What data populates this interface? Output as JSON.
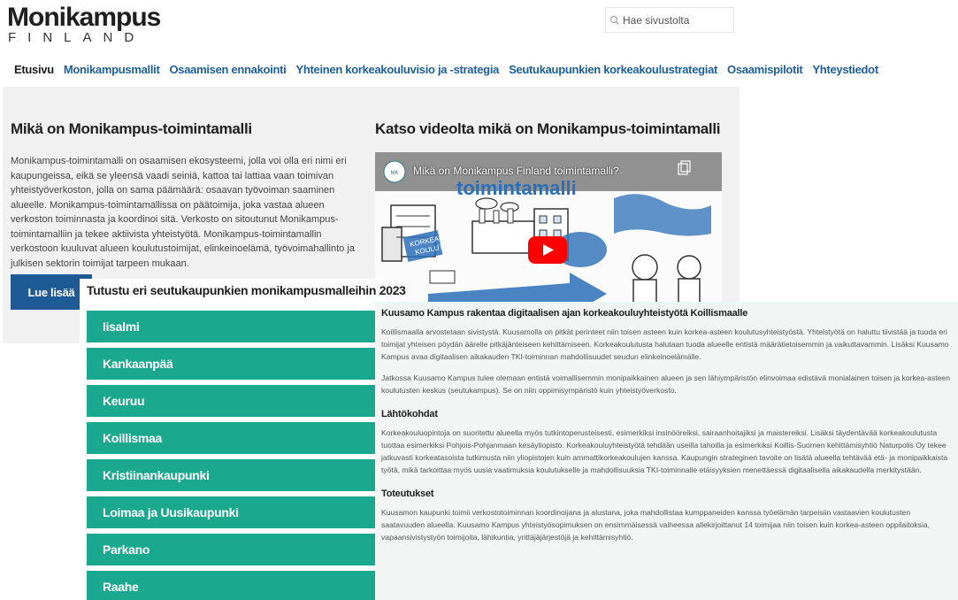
{
  "header": {
    "logo_main": "Monikampus",
    "logo_sub": "FINLAND",
    "search_placeholder": "Hae sivustolta"
  },
  "nav": {
    "items": [
      {
        "label": "Etusivu"
      },
      {
        "label": "Monikampusmallit"
      },
      {
        "label": "Osaamisen ennakointi"
      },
      {
        "label": "Yhteinen korkeakouluvisio ja -strategia"
      },
      {
        "label": "Seutukaupunkien korkeakoulustrategiat"
      },
      {
        "label": "Osaamispilotit"
      },
      {
        "label": "Yhteystiedot"
      }
    ]
  },
  "main": {
    "left_title": "Mikä on Monikampus-toimintamalli",
    "left_text": "Monikampus-toimintamalli on osaamisen ekosysteemi, jolla voi olla eri nimi eri kaupungeissa, eikä se yleensä vaadi seiniä, kattoa tai lattiaa vaan toimivan yhteistyöverkoston, jolla on sama päämäärä: osaavan työvoiman saaminen alueelle. Monikampus-toimintamallissa on päätoimija, joka vastaa alueen verkoston toiminnasta ja koordinoi sitä. Verkosto on sitoutunut Monikampus-toimintamalliin ja tekee aktiivista yhteistyötä. Monikampus-toimintamallin verkostoon kuuluvat alueen koulutustoimijat, elinkeinoelämä, työvoimahallinto ja julkisen sektorin toimijat tarpeen mukaan.",
    "read_more": "Lue lisää",
    "right_title": "Katso videolta mikä on Monikampus-toimintamalli",
    "video_title": "Mikä on Monikampus Finland toimintamalli?"
  },
  "accordion": {
    "heading": "Tutustu eri seutukaupunkien monikampusmalleihin 2023",
    "items": [
      {
        "label": "Iisalmi"
      },
      {
        "label": "Kankaanpää"
      },
      {
        "label": "Keuruu"
      },
      {
        "label": "Koillismaa"
      },
      {
        "label": "Kristiinankaupunki"
      },
      {
        "label": "Loimaa ja Uusikaupunki"
      },
      {
        "label": "Parkano"
      },
      {
        "label": "Raahe"
      }
    ]
  },
  "panel": {
    "title": "Kuusamo Kampus rakentaa digitaalisen ajan korkeakouluyhteistyötä Koillismaalle",
    "p1": "Koillismaalla arvostetaan sivistystä. Kuusamolla on pitkät perinteet niin toisen asteen kuin korkea-asteen koulutusyhteistyöstä. Yhteistyötä on haluttu tiivistää ja tuoda eri toimijat yhteisen pöydän äärelle pitkäjänteiseen kehittämiseen. Korkeakoulutusta halutaan tuoda alueelle entistä määrätietoisemmin ja vaikuttavammin. Lisäksi Kuusamo Kampus avaa digitaalisen aikakauden TKI-toiminnan mahdollisuudet seudun elinkeinoelämälle.",
    "p2": "Jatkossa Kuusamo Kampus tulee olemaan entistä voimallisemmin monipaikkainen alueen ja sen lähiympäristön elinvoimaa edistävä monialainen toisen ja korkea-asteen koulutusten keskus (seutukampus). Se on niin oppimisympäristö kuin yhteistyöverkosto.",
    "h2": "Lähtökohdat",
    "p3": "Korkeakouluopintoja on suoritettu alueella myös tutkintoperusteisesti, esimerkiksi insinööreiksi, sairaanhoitajiksi ja maistereiksi. Lisäksi täydentävää korkeakoulutusta tuottaa esimerkiksi Pohjois-Pohjanmaan kesäyliopisto. Korkeakouluyhteistyötä tehdään useilla tahoilla ja esimerkiksi Koillis-Suomen kehittämisyhtiö Naturpolis Oy tekee jatkuvasti korkeatasoista tutkimusta niin yliopistojen kuin ammattikorkeakoulujen kanssa. Kaupungin strateginen tavoite on lisätä alueella tehtävää etä- ja monipaikkaista työtä, mikä tarkoittaa myös uusia vaatimuksia koulutukselle ja mahdollisuuksia TKI-toiminnalle etäisyyksien menettäessä digitaalisella aikakaudella merkitystään.",
    "h3": "Toteutukset",
    "p4": "Kuusamon kaupunki toimii verkostotoiminnan koordinoijana ja alustana, joka mahdollistaa kumppaneiden kanssa työelämän tarpeisiin vastaavien koulutusten saatavuuden alueella. Kuusamo Kampus yhteistyösopimuksen on ensimmäisessä vaiheessa allekirjoittanut 14 toimijaa niin toisen kuin korkea-asteen oppilaitoksia, vapaansivistystyön toimijoita, lähikuntia, yrittäjäjärjestöjä ja kehittämisyhtiö."
  },
  "colors": {
    "nav_link": "#1d5f9b",
    "button": "#1d5a96",
    "accordion": "#1aa98f",
    "panel_bg": "#f3f4f4"
  }
}
